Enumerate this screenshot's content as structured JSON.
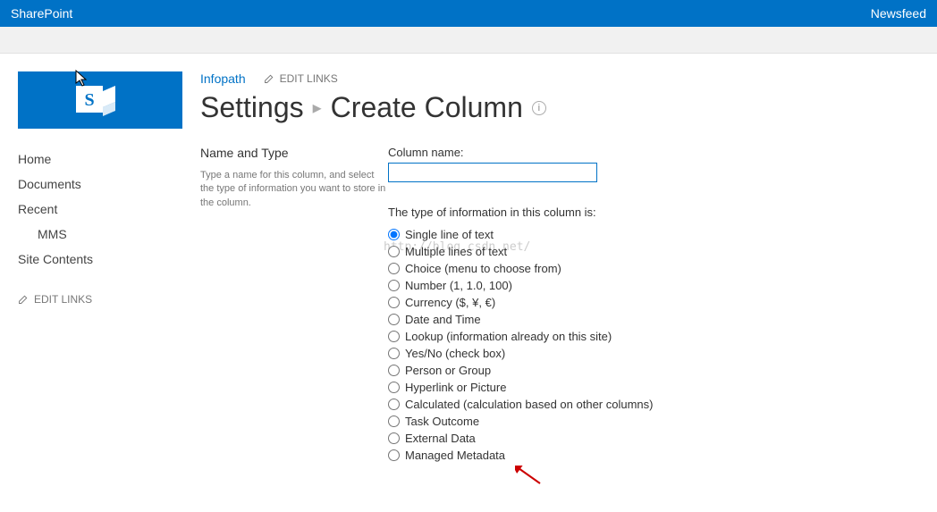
{
  "suiteBar": {
    "brand": "SharePoint",
    "right": "Newsfeed"
  },
  "crumb": {
    "siteLink": "Infopath",
    "editLinks": "EDIT LINKS"
  },
  "pageTitle": {
    "settings": "Settings",
    "page": "Create Column"
  },
  "nav": {
    "items": [
      "Home",
      "Documents",
      "Recent"
    ],
    "subItems": [
      "MMS"
    ],
    "afterSub": [
      "Site Contents"
    ],
    "editLinks": "EDIT LINKS"
  },
  "section": {
    "heading": "Name and Type",
    "desc": "Type a name for this column, and select the type of information you want to store in the column."
  },
  "form": {
    "colNameLabel": "Column name:",
    "colNameValue": "",
    "radioPrompt": "The type of information in this column is:",
    "options": [
      "Single line of text",
      "Multiple lines of text",
      "Choice (menu to choose from)",
      "Number (1, 1.0, 100)",
      "Currency ($, ¥, €)",
      "Date and Time",
      "Lookup (information already on this site)",
      "Yes/No (check box)",
      "Person or Group",
      "Hyperlink or Picture",
      "Calculated (calculation based on other columns)",
      "Task Outcome",
      "External Data",
      "Managed Metadata"
    ],
    "selectedIndex": 0
  }
}
